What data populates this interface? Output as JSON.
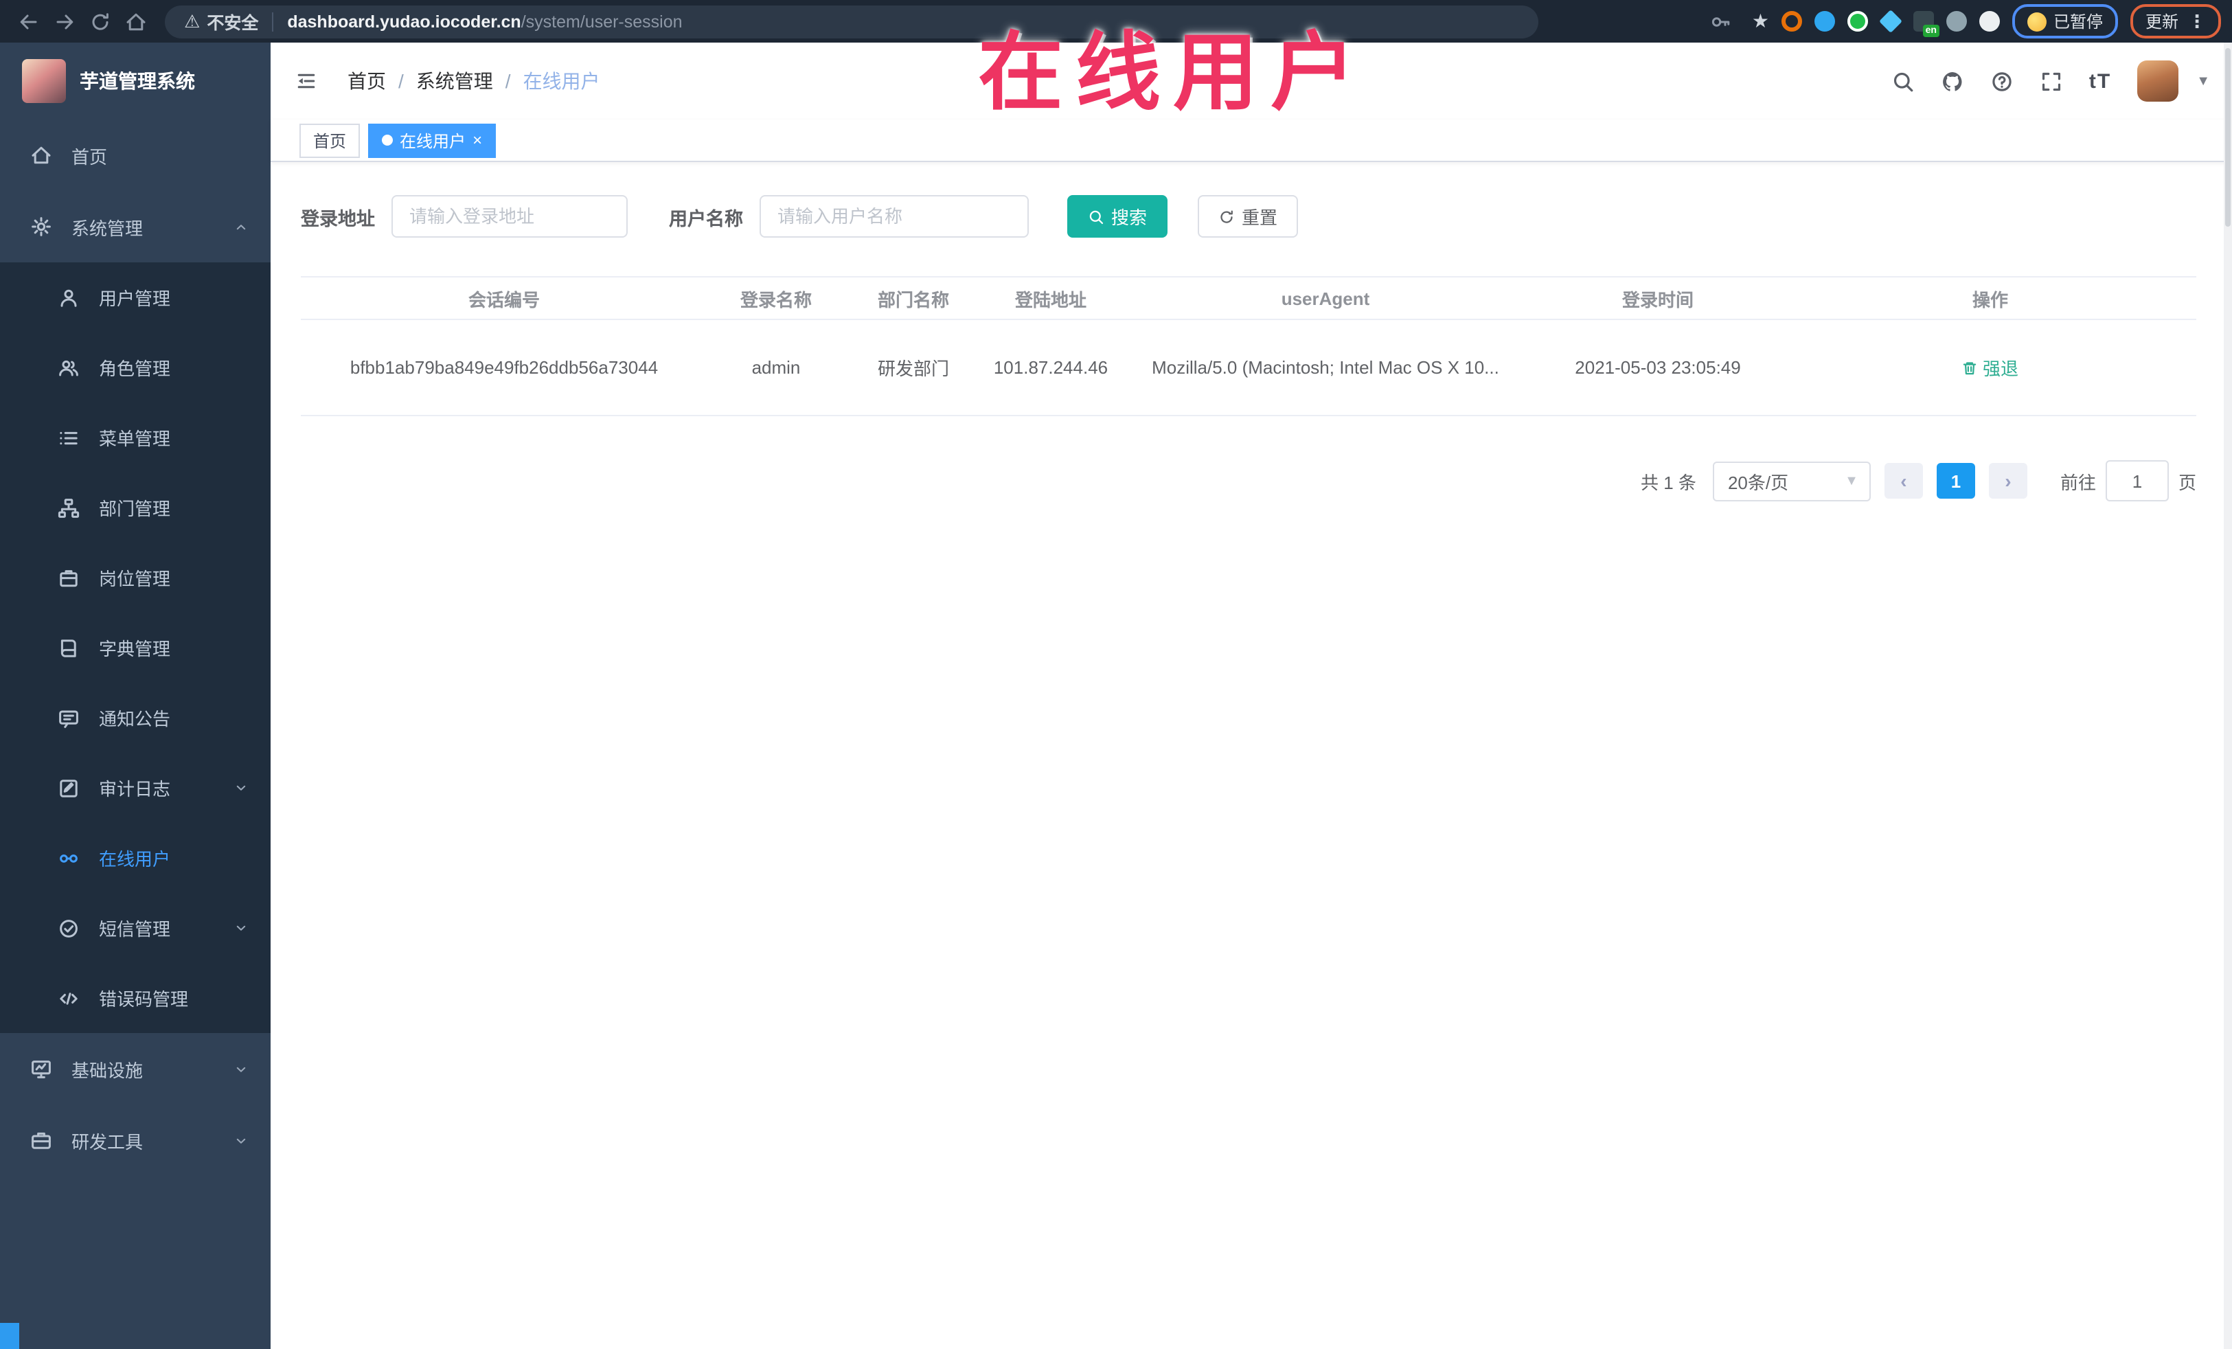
{
  "browser": {
    "security_label": "不安全",
    "url_host": "dashboard.yudao.iocoder.cn",
    "url_path": "/system/user-session",
    "extension_badge": "en",
    "paused_label": "已暂停",
    "update_label": "更新",
    "extensions": [
      {
        "name": "ext-orange-ring-icon",
        "color": "#e8710a",
        "style": "ring"
      },
      {
        "name": "ext-blue-drop-icon",
        "color": "#2fa7f0",
        "style": "solid"
      },
      {
        "name": "ext-green-circle-icon",
        "color": "#21bf4b",
        "style": "ringed"
      },
      {
        "name": "ext-blue-diamond-icon",
        "color": "#4fc3f7",
        "style": "diamond"
      },
      {
        "name": "ext-translate-icon",
        "color": "#37474f",
        "style": "badge"
      },
      {
        "name": "ext-gray-icon",
        "color": "#90a4ae",
        "style": "solid"
      },
      {
        "name": "ext-puzzle-icon",
        "color": "#eceff1",
        "style": "solid"
      }
    ]
  },
  "annotation": {
    "text": "在线用户",
    "color": "#ee3462"
  },
  "sidebar": {
    "logo_title": "芋道管理系统",
    "items": [
      {
        "label": "首页",
        "icon": "home-icon",
        "level": 1
      },
      {
        "label": "系统管理",
        "icon": "gear-icon",
        "level": 1,
        "arrow": "up"
      },
      {
        "label": "用户管理",
        "icon": "user-icon",
        "level": 2
      },
      {
        "label": "角色管理",
        "icon": "users-icon",
        "level": 2
      },
      {
        "label": "菜单管理",
        "icon": "menu-list-icon",
        "level": 2
      },
      {
        "label": "部门管理",
        "icon": "org-tree-icon",
        "level": 2
      },
      {
        "label": "岗位管理",
        "icon": "badge-icon",
        "level": 2
      },
      {
        "label": "字典管理",
        "icon": "book-icon",
        "level": 2
      },
      {
        "label": "通知公告",
        "icon": "notice-icon",
        "level": 2
      },
      {
        "label": "审计日志",
        "icon": "log-icon",
        "level": 2,
        "arrow": "down"
      },
      {
        "label": "在线用户",
        "icon": "online-icon",
        "level": 2,
        "active": true
      },
      {
        "label": "短信管理",
        "icon": "sms-check-icon",
        "level": 2,
        "arrow": "down"
      },
      {
        "label": "错误码管理",
        "icon": "code-icon",
        "level": 2
      },
      {
        "label": "基础设施",
        "icon": "monitor-icon",
        "level": 1,
        "arrow": "down"
      },
      {
        "label": "研发工具",
        "icon": "tools-icon",
        "level": 1,
        "arrow": "down"
      }
    ]
  },
  "navbar": {
    "breadcrumb": [
      "首页",
      "系统管理",
      "在线用户"
    ],
    "right_icons": [
      "search-icon",
      "github-icon",
      "help-icon",
      "fullscreen-icon"
    ],
    "textsize_label": "tT"
  },
  "tags": [
    {
      "label": "首页",
      "active": false
    },
    {
      "label": "在线用户",
      "active": true,
      "closable": true
    }
  ],
  "filters": {
    "addr_label": "登录地址",
    "addr_placeholder": "请输入登录地址",
    "name_label": "用户名称",
    "name_placeholder": "请输入用户名称",
    "search_label": "搜索",
    "reset_label": "重置"
  },
  "table": {
    "columns": [
      "会话编号",
      "登录名称",
      "部门名称",
      "登陆地址",
      "userAgent",
      "登录时间",
      "操作"
    ],
    "rows": [
      {
        "session": "bfbb1ab79ba849e49fb26ddb56a73044",
        "login": "admin",
        "dept": "研发部门",
        "addr": "101.87.244.46",
        "agent": "Mozilla/5.0 (Macintosh; Intel Mac OS X 10...",
        "time": "2021-05-03 23:05:49",
        "action": "强退"
      }
    ]
  },
  "pagination": {
    "total": "共 1 条",
    "page_size": "20条/页",
    "prev": "‹",
    "current": "1",
    "next": "›",
    "goto_label": "前往",
    "goto_value": "1",
    "page_label": "页"
  }
}
